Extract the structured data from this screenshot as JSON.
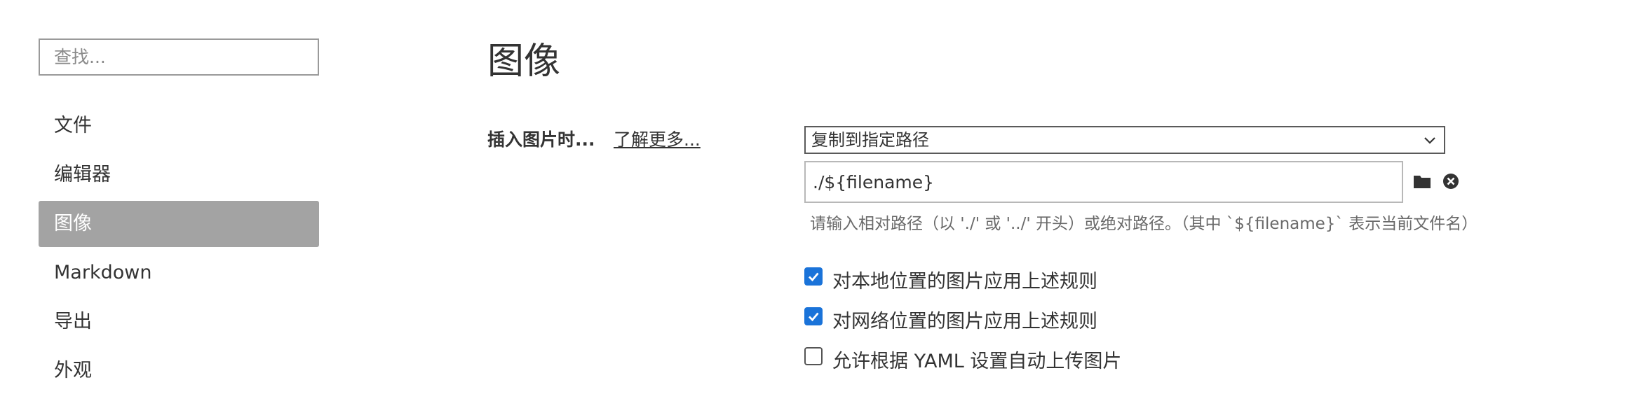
{
  "sidebar": {
    "search_placeholder": "查找...",
    "items": [
      {
        "label": "文件"
      },
      {
        "label": "编辑器"
      },
      {
        "label": "图像",
        "active": true
      },
      {
        "label": "Markdown"
      },
      {
        "label": "导出"
      },
      {
        "label": "外观"
      }
    ]
  },
  "main": {
    "title": "图像",
    "insert_label": "插入图片时...",
    "learn_more": "了解更多...",
    "insert_action": {
      "selected": "复制到指定路径",
      "icon": "chevron-down-icon"
    },
    "path": {
      "value": "./${filename}",
      "hint": "请输入相对路径（以 './' 或 '../' 开头）或绝对路径。（其中 `${filename}` 表示当前文件名）"
    },
    "options": [
      {
        "label": "对本地位置的图片应用上述规则",
        "checked": true
      },
      {
        "label": "对网络位置的图片应用上述规则",
        "checked": true
      },
      {
        "label": "允许根据 YAML 设置自动上传图片",
        "checked": false
      }
    ]
  },
  "colors": {
    "accent": "#1a73d9",
    "active_nav_bg": "#a3a3a3"
  }
}
